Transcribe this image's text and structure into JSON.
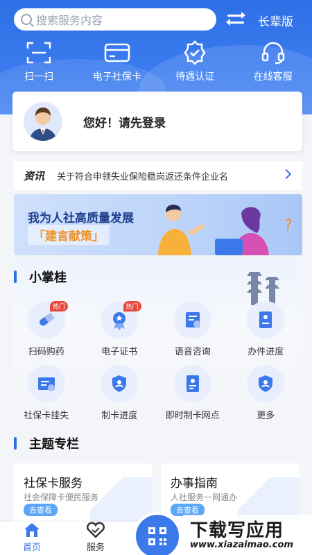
{
  "header": {
    "search_placeholder": "搜索服务内容",
    "elder_mode": "长辈版",
    "quick": [
      {
        "icon": "scan-icon",
        "label": "扫一扫"
      },
      {
        "icon": "card-icon",
        "label": "电子社保卡"
      },
      {
        "icon": "badge-check-icon",
        "label": "待遇认证"
      },
      {
        "icon": "headset-icon",
        "label": "在线客服"
      }
    ]
  },
  "login": {
    "greeting": "您好！请先登录"
  },
  "news": {
    "tag": "资讯",
    "text": "关于符合申领失业保险稳岗返还条件企业名"
  },
  "banner": {
    "line1": "我为人社高质量发展",
    "line2": "「建言献策」"
  },
  "services": {
    "title": "小掌桂",
    "items": [
      {
        "icon": "medicine-icon",
        "label": "扫码购药",
        "badge": "热门"
      },
      {
        "icon": "certificate-icon",
        "label": "电子证书",
        "badge": "热门"
      },
      {
        "icon": "voice-consult-icon",
        "label": "语音咨询",
        "badge": ""
      },
      {
        "icon": "progress-doc-icon",
        "label": "办件进度",
        "badge": ""
      },
      {
        "icon": "card-lost-icon",
        "label": "社保卡挂失",
        "badge": ""
      },
      {
        "icon": "card-progress-icon",
        "label": "制卡进度",
        "badge": ""
      },
      {
        "icon": "instant-card-icon",
        "label": "即时制卡网点",
        "badge": ""
      },
      {
        "icon": "more-icon",
        "label": "更多",
        "badge": ""
      }
    ]
  },
  "topics": {
    "title": "主题专栏",
    "cards": [
      {
        "title": "社保卡服务",
        "subtitle": "社会保障卡便民服务",
        "action": "去查看"
      },
      {
        "title": "办事指南",
        "subtitle": "人社服务一网通办",
        "action": "去查看"
      }
    ]
  },
  "tabbar": {
    "home": "首页",
    "service": "服务"
  },
  "watermark": {
    "line1": "下载写应用",
    "line2": "www.xiazaimao.com"
  },
  "colors": {
    "primary": "#2f6fe6",
    "hot": "#e8483f"
  }
}
